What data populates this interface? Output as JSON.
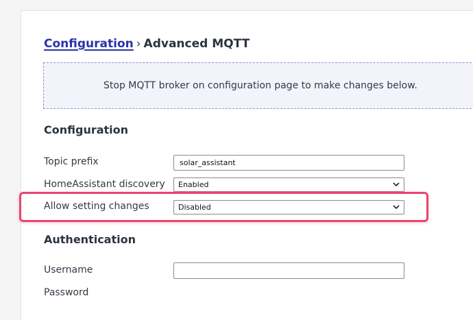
{
  "breadcrumb": {
    "parent": "Configuration",
    "separator": "›",
    "current": "Advanced MQTT"
  },
  "notice": "Stop MQTT broker on configuration page to make changes below.",
  "configuration": {
    "title": "Configuration",
    "topic_prefix": {
      "label": "Topic prefix",
      "value": "solar_assistant"
    },
    "ha_discovery": {
      "label": "HomeAssistant discovery",
      "value": "Enabled"
    },
    "allow_changes": {
      "label": "Allow setting changes",
      "value": "Disabled"
    }
  },
  "authentication": {
    "title": "Authentication",
    "username": {
      "label": "Username",
      "value": ""
    },
    "password": {
      "label": "Password"
    }
  },
  "colors": {
    "link": "#2a33a8",
    "highlight": "#e8446f",
    "notice_border": "#8f8fd6",
    "notice_bg": "#f3f3fb"
  }
}
